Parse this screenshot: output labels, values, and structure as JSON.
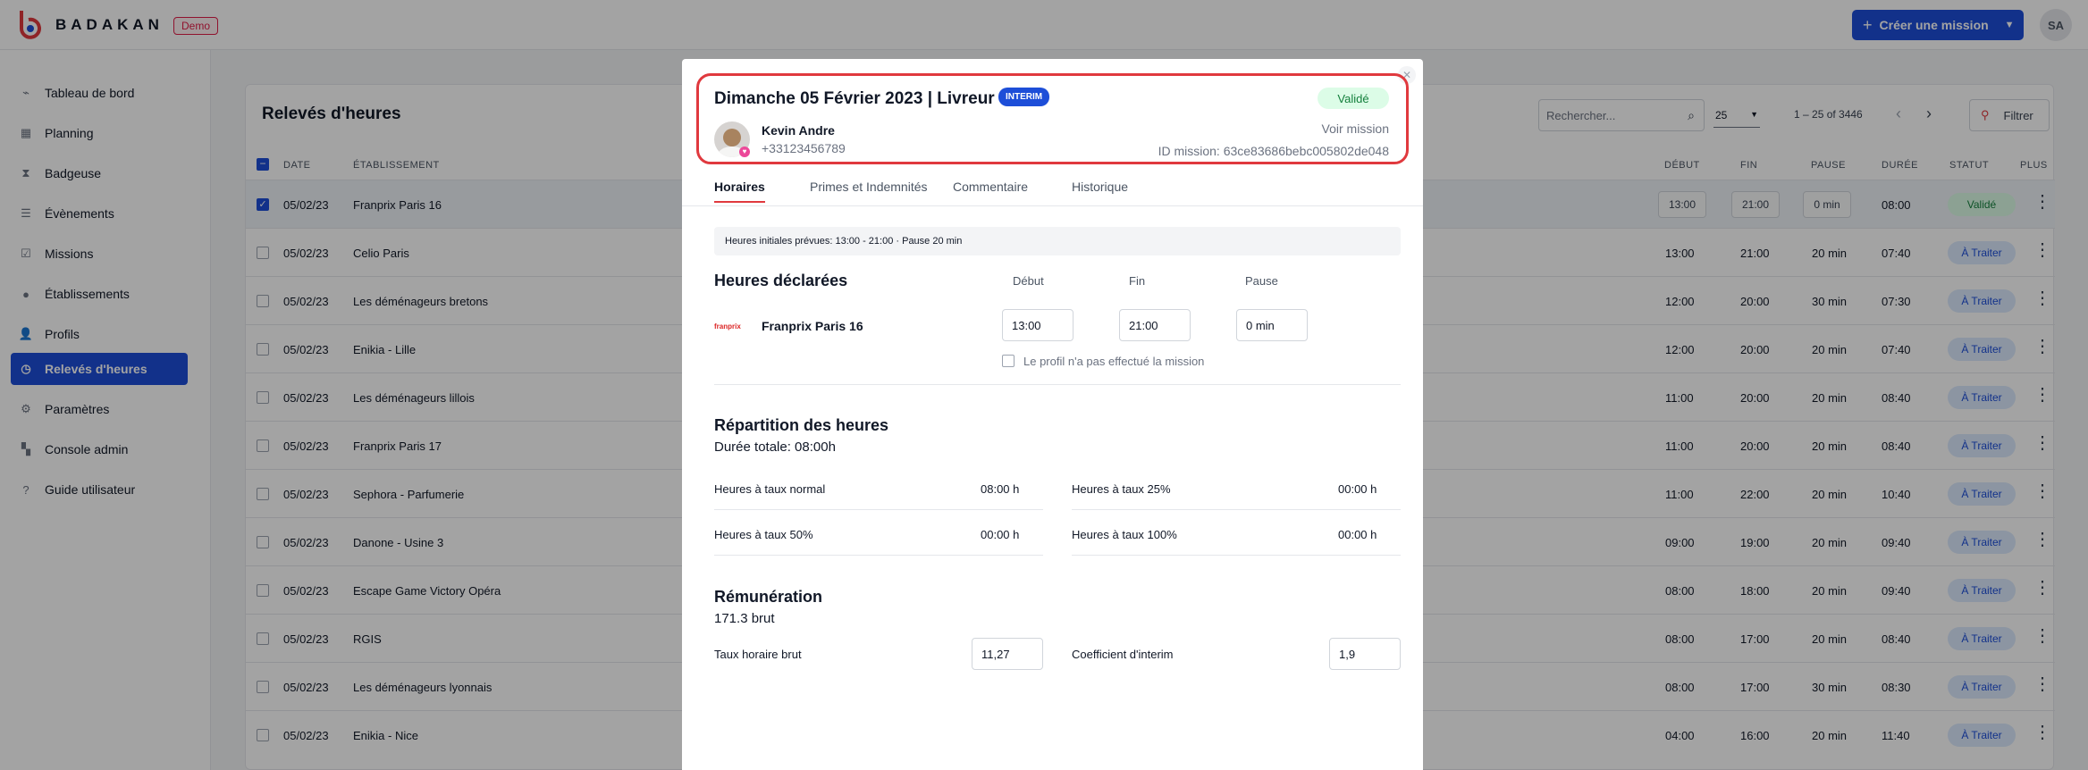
{
  "header": {
    "brand": "BADAKAN",
    "demo_badge": "Demo",
    "create_button": "Créer une mission",
    "user_initials": "SA"
  },
  "sidebar": {
    "items": [
      {
        "label": "Tableau de bord",
        "icon": "dashboard-icon"
      },
      {
        "label": "Planning",
        "icon": "calendar-icon"
      },
      {
        "label": "Badgeuse",
        "icon": "hourglass-icon"
      },
      {
        "label": "Évènements",
        "icon": "events-icon"
      },
      {
        "label": "Missions",
        "icon": "check-square-icon"
      },
      {
        "label": "Établissements",
        "icon": "building-icon"
      },
      {
        "label": "Profils",
        "icon": "user-icon"
      },
      {
        "label": "Relevés d'heures",
        "icon": "clock-icon",
        "active": true
      },
      {
        "label": "Paramètres",
        "icon": "gear-icon"
      },
      {
        "label": "Console admin",
        "icon": "grid-icon"
      },
      {
        "label": "Guide utilisateur",
        "icon": "help-icon"
      }
    ]
  },
  "page": {
    "title": "Relevés d'heures",
    "search_placeholder": "Rechercher...",
    "per_page": "25",
    "range": "1 – 25 of 3446",
    "filter": "Filtrer",
    "columns": {
      "date": "DATE",
      "establishment": "ÉTABLISSEMENT",
      "start": "DÉBUT",
      "end": "FIN",
      "pause": "PAUSE",
      "duration": "DURÉE",
      "status": "STATUT",
      "more": "PLUS"
    },
    "rows": [
      {
        "date": "05/02/23",
        "establishment": "Franprix Paris 16",
        "start": "13:00",
        "end": "21:00",
        "pause": "0 min",
        "duration": "08:00",
        "status": "Validé",
        "selected": true
      },
      {
        "date": "05/02/23",
        "establishment": "Celio Paris",
        "start": "13:00",
        "end": "21:00",
        "pause": "20 min",
        "duration": "07:40",
        "status": "À Traiter"
      },
      {
        "date": "05/02/23",
        "establishment": "Les déménageurs bretons",
        "start": "12:00",
        "end": "20:00",
        "pause": "30 min",
        "duration": "07:30",
        "status": "À Traiter"
      },
      {
        "date": "05/02/23",
        "establishment": "Enikia - Lille",
        "start": "12:00",
        "end": "20:00",
        "pause": "20 min",
        "duration": "07:40",
        "status": "À Traiter"
      },
      {
        "date": "05/02/23",
        "establishment": "Les déménageurs lillois",
        "start": "11:00",
        "end": "20:00",
        "pause": "20 min",
        "duration": "08:40",
        "status": "À Traiter"
      },
      {
        "date": "05/02/23",
        "establishment": "Franprix Paris 17",
        "start": "11:00",
        "end": "20:00",
        "pause": "20 min",
        "duration": "08:40",
        "status": "À Traiter"
      },
      {
        "date": "05/02/23",
        "establishment": "Sephora - Parfumerie",
        "start": "11:00",
        "end": "22:00",
        "pause": "20 min",
        "duration": "10:40",
        "status": "À Traiter"
      },
      {
        "date": "05/02/23",
        "establishment": "Danone - Usine 3",
        "start": "09:00",
        "end": "19:00",
        "pause": "20 min",
        "duration": "09:40",
        "status": "À Traiter"
      },
      {
        "date": "05/02/23",
        "establishment": "Escape Game Victory Opéra",
        "start": "08:00",
        "end": "18:00",
        "pause": "20 min",
        "duration": "09:40",
        "status": "À Traiter"
      },
      {
        "date": "05/02/23",
        "establishment": "RGIS",
        "start": "08:00",
        "end": "17:00",
        "pause": "20 min",
        "duration": "08:40",
        "status": "À Traiter"
      },
      {
        "date": "05/02/23",
        "establishment": "Les déménageurs lyonnais",
        "start": "08:00",
        "end": "17:00",
        "pause": "30 min",
        "duration": "08:30",
        "status": "À Traiter"
      },
      {
        "date": "05/02/23",
        "establishment": "Enikia - Nice",
        "start": "04:00",
        "end": "16:00",
        "pause": "20 min",
        "duration": "11:40",
        "status": "À Traiter"
      }
    ]
  },
  "modal": {
    "title": "Dimanche 05 Février 2023 | Livreur",
    "interim_badge": "INTERIM",
    "status": "Validé",
    "worker_name": "Kevin Andre",
    "worker_phone": "+33123456789",
    "voir_mission": "Voir mission",
    "mission_id": "ID mission: 63ce83686bebc005802de048",
    "tabs": [
      "Horaires",
      "Primes et Indemnités",
      "Commentaire",
      "Historique"
    ],
    "initial_hours": "Heures initiales prévues: 13:00 - 21:00 · Pause 20 min",
    "declared": {
      "title": "Heures déclarées",
      "col_start": "Début",
      "col_end": "Fin",
      "col_pause": "Pause",
      "establishment": "Franprix Paris 16",
      "establishment_logo": "franprix",
      "start": "13:00",
      "end": "21:00",
      "pause": "0 min",
      "not_done_label": "Le profil n'a pas effectué la mission"
    },
    "repartition": {
      "title": "Répartition des heures",
      "total": "Durée totale: 08:00h",
      "rates": [
        {
          "label": "Heures à taux normal",
          "value": "08:00 h"
        },
        {
          "label": "Heures à taux 25%",
          "value": "00:00 h"
        },
        {
          "label": "Heures à taux 50%",
          "value": "00:00 h"
        },
        {
          "label": "Heures à taux 100%",
          "value": "00:00 h"
        }
      ]
    },
    "remuneration": {
      "title": "Rémunération",
      "amount": "171.3 brut",
      "rate_label": "Taux horaire brut",
      "rate_value": "11,27",
      "coef_label": "Coefficient d'interim",
      "coef_value": "1,9"
    }
  },
  "colors": {
    "primary": "#1d4ed8",
    "highlight": "#e0393e",
    "valid_bg": "#dcfce7",
    "valid_text": "#15803d"
  }
}
